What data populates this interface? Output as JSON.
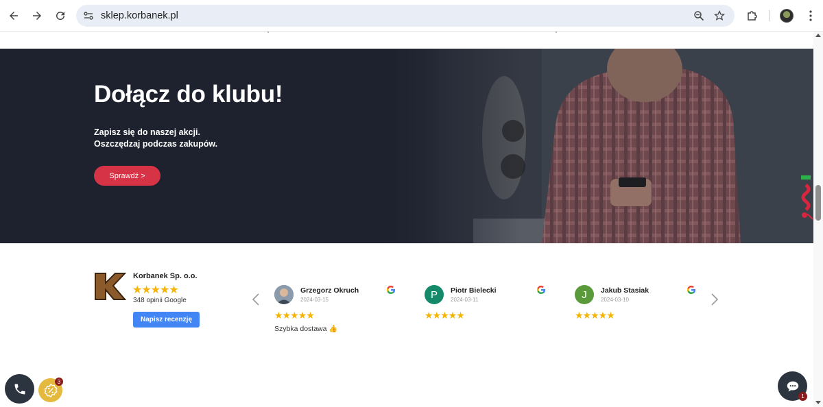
{
  "browser": {
    "url": "sklep.korbanek.pl",
    "back_icon": "arrow-left-icon",
    "forward_icon": "arrow-right-icon",
    "reload_icon": "reload-icon",
    "site_info_icon": "tune-icon",
    "zoom_icon": "zoom-out-icon",
    "bookmark_icon": "star-icon",
    "extensions_icon": "puzzle-icon",
    "menu_icon": "kebab-menu-icon"
  },
  "hero": {
    "title": "Dołącz do klubu!",
    "subtitle_line1": "Zapisz się do naszej akcji.",
    "subtitle_line2": "Oszczędzaj podczas zakupów.",
    "button_label": "Sprawdź >",
    "button_color": "#d63346"
  },
  "business": {
    "name": "Korbanek Sp. o.o.",
    "rating_stars": "★★★★★",
    "rating_value": 4.5,
    "reviews_count_text": "348 opinii Google",
    "write_review_label": "Napisz recenzję",
    "accent_color": "#4285f4"
  },
  "reviews": [
    {
      "name": "Grzegorz Okruch",
      "date": "2024-03-15",
      "avatar_letter": "",
      "avatar_color": "#6b7b8c",
      "stars": "★★★★★",
      "rating": 5,
      "text": "Szybka dostawa 👍"
    },
    {
      "name": "Piotr Bielecki",
      "date": "2024-03-11",
      "avatar_letter": "P",
      "avatar_color": "#158a6a",
      "stars": "★★★★★",
      "rating": 5,
      "text": ""
    },
    {
      "name": "Jakub Stasiak",
      "date": "2024-03-10",
      "avatar_letter": "J",
      "avatar_color": "#5b9a3b",
      "stars": "★★★★★",
      "rating": 5,
      "text": ""
    }
  ],
  "floating": {
    "promo_badge": "3",
    "chat_badge": "1"
  }
}
